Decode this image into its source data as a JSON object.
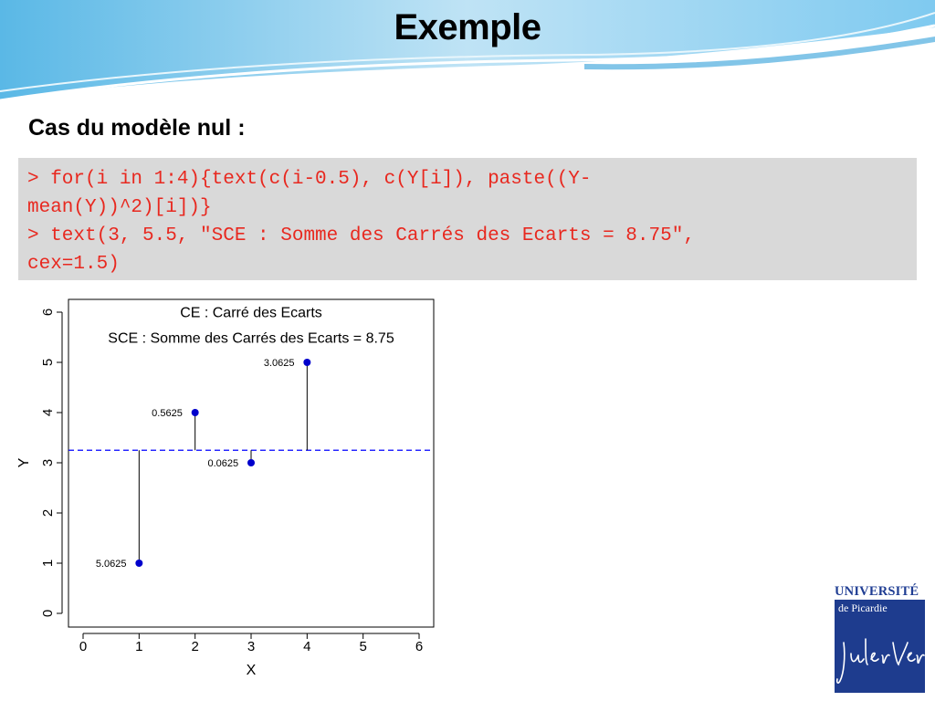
{
  "slide": {
    "title": "Exemple",
    "subtitle": "Cas du modèle nul :"
  },
  "code": {
    "lines": [
      "> for(i in 1:4){text(c(i-0.5), c(Y[i]), paste((Y-",
      "mean(Y))^2)[i])}",
      "> text(3, 5.5, \"SCE : Somme des Carrés des Ecarts = 8.75\",",
      "cex=1.5)"
    ],
    "color": "#e8281f"
  },
  "logo": {
    "line1": "UNIVERSITÉ",
    "line2": "de Picardie",
    "signature": "Jules Verne"
  },
  "chart_data": {
    "type": "scatter",
    "title": "CE : Carré des Ecarts",
    "annotation": "SCE : Somme des Carrés des Ecarts = 8.75",
    "xlabel": "X",
    "ylabel": "Y",
    "xlim": [
      0,
      6
    ],
    "ylim": [
      0,
      6
    ],
    "xticks": [
      0,
      1,
      2,
      3,
      4,
      5,
      6
    ],
    "yticks": [
      0,
      1,
      2,
      3,
      4,
      5,
      6
    ],
    "x": [
      1,
      2,
      3,
      4
    ],
    "y": [
      1,
      4,
      3,
      5
    ],
    "point_labels": [
      "5.0625",
      "0.5625",
      "0.0625",
      "3.0625"
    ],
    "mean_line": 3.25,
    "point_color": "#0000cc",
    "mean_line_color": "#0000ff",
    "grid": false
  }
}
